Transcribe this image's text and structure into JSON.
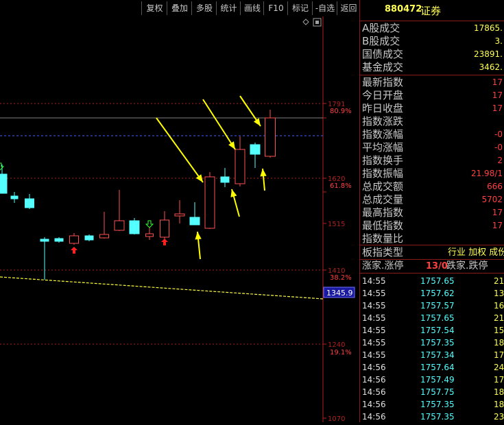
{
  "toolbar": {
    "buttons": [
      "复权",
      "叠加",
      "多股",
      "统计",
      "画线",
      "F10",
      "标记",
      "-自选",
      "返回"
    ]
  },
  "chart": {
    "price_labels": [
      "1791",
      "80.9%",
      "1620",
      "61.8%",
      "1515",
      "1410",
      "38.2%",
      "1345.9",
      "1240",
      "19.1%",
      "1070"
    ],
    "icons": [
      "diamond-icon",
      "window-icon"
    ]
  },
  "panel": {
    "code": "880472",
    "name": "证券",
    "rows1": [
      {
        "label": "A股成交",
        "value": "17865."
      },
      {
        "label": "B股成交",
        "value": "3."
      },
      {
        "label": "国债成交",
        "value": "23891."
      },
      {
        "label": "基金成交",
        "value": "3462."
      }
    ],
    "rows2": [
      {
        "label": "最新指数",
        "value": "17"
      },
      {
        "label": "今日开盘",
        "value": "17"
      },
      {
        "label": "昨日收盘",
        "value": "17"
      },
      {
        "label": "指数涨跌",
        "value": ""
      },
      {
        "label": "指数涨幅",
        "value": "-0"
      },
      {
        "label": "平均涨幅",
        "value": "-0"
      },
      {
        "label": "指数换手",
        "value": "2"
      },
      {
        "label": "指数振幅",
        "value": "21.98/1"
      },
      {
        "label": "总成交额",
        "value": "666"
      },
      {
        "label": "总成交量",
        "value": "5702"
      },
      {
        "label": "最高指数",
        "value": "17"
      },
      {
        "label": "最低指数",
        "value": "17"
      },
      {
        "label": "指数量比",
        "value": ""
      }
    ],
    "board_type_label": "板指类型",
    "board_type_value": "行业 加权 成份",
    "rise_label": "涨家.涨停",
    "rise_value": "13/0",
    "fall_label": "跌家.跌停",
    "ticks": [
      {
        "time": "14:55",
        "price": "1757.65",
        "vol": "21"
      },
      {
        "time": "14:55",
        "price": "1757.62",
        "vol": "13"
      },
      {
        "time": "14:55",
        "price": "1757.57",
        "vol": "16"
      },
      {
        "time": "14:55",
        "price": "1757.65",
        "vol": "21"
      },
      {
        "time": "14:55",
        "price": "1757.54",
        "vol": "15"
      },
      {
        "time": "14:55",
        "price": "1757.35",
        "vol": "18"
      },
      {
        "time": "14:55",
        "price": "1757.34",
        "vol": "17"
      },
      {
        "time": "14:56",
        "price": "1757.64",
        "vol": "24"
      },
      {
        "time": "14:56",
        "price": "1757.49",
        "vol": "17"
      },
      {
        "time": "14:56",
        "price": "1757.75",
        "vol": "18"
      },
      {
        "time": "14:56",
        "price": "1757.35",
        "vol": "18"
      },
      {
        "time": "14:56",
        "price": "1757.35",
        "vol": "23"
      }
    ]
  },
  "colors": {
    "up": "#ff5050",
    "down": "#54ffff",
    "label_red": "#ff4040",
    "value_yellow": "#ffff55",
    "annotation": "#ffff00",
    "separator": "#8a1a1a"
  }
}
